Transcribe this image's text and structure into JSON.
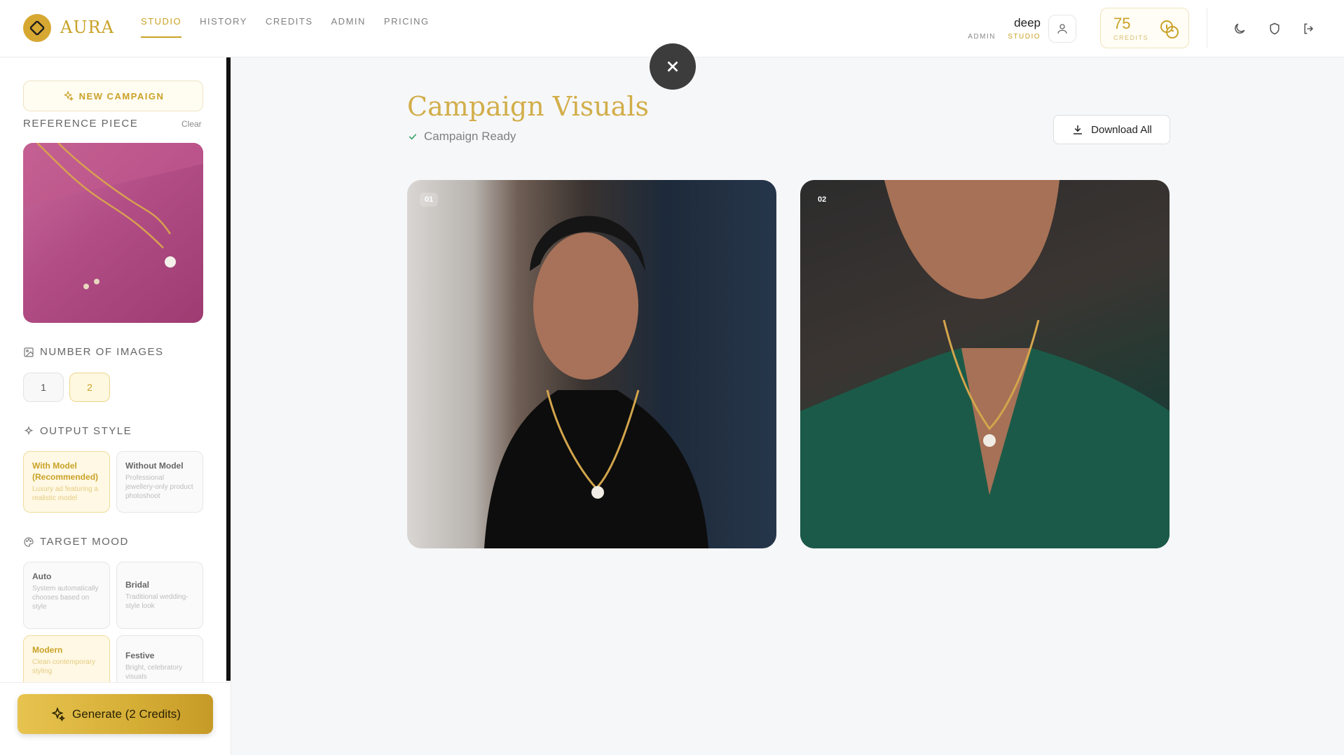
{
  "app": {
    "name": "AURA"
  },
  "nav": [
    {
      "label": "STUDIO",
      "active": true
    },
    {
      "label": "HISTORY",
      "active": false
    },
    {
      "label": "CREDITS",
      "active": false
    },
    {
      "label": "ADMIN",
      "active": false
    },
    {
      "label": "PRICING",
      "active": false
    }
  ],
  "user": {
    "name": "deep",
    "role1": "ADMIN",
    "role2": "STUDIO"
  },
  "credits": {
    "value": "75",
    "label": "CREDITS"
  },
  "sidebar": {
    "new_campaign": "NEW CAMPAIGN",
    "reference_label": "REFERENCE PIECE",
    "clear": "Clear",
    "num_images_label": "NUMBER OF IMAGES",
    "num_options": [
      "1",
      "2"
    ],
    "num_selected": "2",
    "output_style_label": "OUTPUT STYLE",
    "output_styles": [
      {
        "title": "With Model (Recommended)",
        "desc": "Luxury ad featuring a realistic model",
        "selected": true
      },
      {
        "title": "Without Model",
        "desc": "Professional jewellery-only product photoshoot",
        "selected": false
      }
    ],
    "target_mood_label": "TARGET MOOD",
    "moods": [
      {
        "title": "Auto",
        "desc": "System automatically chooses based on style",
        "selected": false
      },
      {
        "title": "Bridal",
        "desc": "Traditional wedding-style look",
        "selected": false
      },
      {
        "title": "Modern",
        "desc": "Clean contemporary styling",
        "selected": true
      },
      {
        "title": "Festive",
        "desc": "Bright, celebratory visuals",
        "selected": false
      }
    ],
    "generate": "Generate (2 Credits)"
  },
  "main": {
    "title": "Campaign Visuals",
    "status": "Campaign Ready",
    "download_all": "Download All",
    "images": [
      {
        "tag": "01"
      },
      {
        "tag": "02"
      }
    ]
  },
  "colors": {
    "accent": "#c9a227",
    "dark": "#3c3c3c"
  }
}
